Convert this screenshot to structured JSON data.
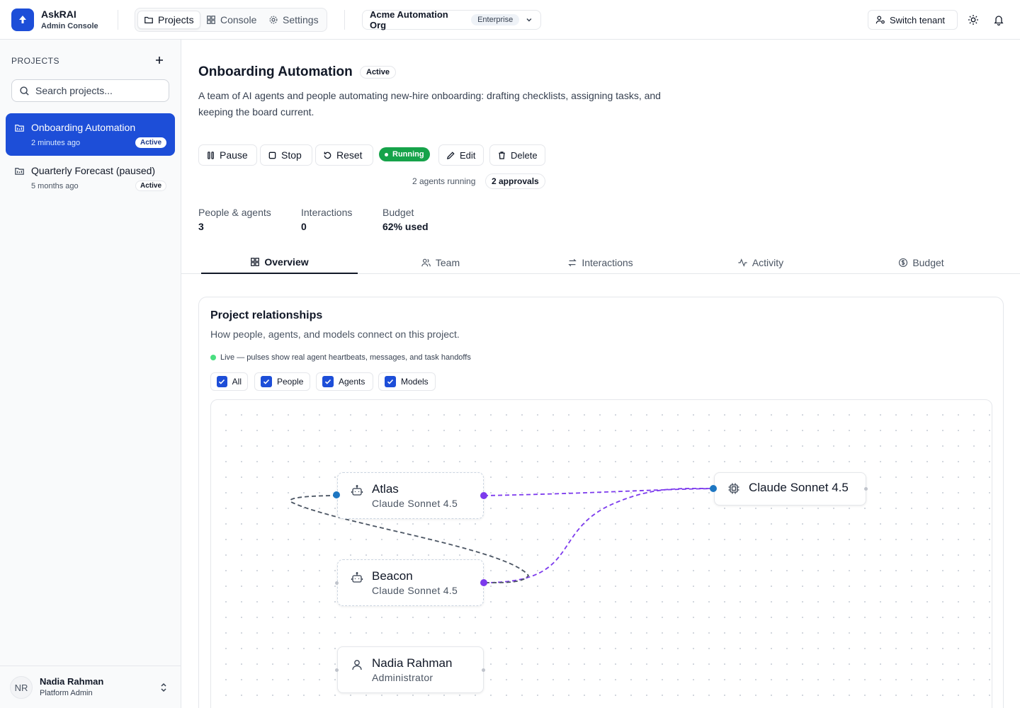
{
  "app": {
    "name": "AskRAI",
    "subtitle": "Admin Console"
  },
  "topnav": [
    {
      "label": "Projects",
      "icon": "folder-icon",
      "active": true
    },
    {
      "label": "Console",
      "icon": "grid-icon",
      "active": false
    },
    {
      "label": "Settings",
      "icon": "gear-icon",
      "active": false
    }
  ],
  "org": {
    "name": "Acme Automation Org",
    "tier": "Enterprise"
  },
  "header_actions": {
    "switch_tenant": "Switch tenant"
  },
  "sidebar": {
    "heading": "PROJECTS",
    "search_placeholder": "Search projects...",
    "projects": [
      {
        "title": "Onboarding Automation",
        "time": "2 minutes ago",
        "badge": "Active",
        "active": true
      },
      {
        "title": "Quarterly Forecast (paused)",
        "time": "5 months ago",
        "badge": "Active",
        "active": false
      }
    ],
    "user": {
      "initials": "NR",
      "name": "Nadia Rahman",
      "role": "Platform Admin"
    }
  },
  "project": {
    "title": "Onboarding Automation",
    "status": "Active",
    "description": "A team of AI agents and people automating new-hire onboarding: drafting checklists, assigning tasks, and keeping the board current.",
    "actions": {
      "pause": "Pause",
      "stop": "Stop",
      "reset": "Reset",
      "running": "Running",
      "edit": "Edit",
      "delete": "Delete"
    },
    "agents_running": "2 agents running",
    "approvals": "2 approvals",
    "stats": [
      {
        "label": "People & agents",
        "value": "3"
      },
      {
        "label": "Interactions",
        "value": "0"
      },
      {
        "label": "Budget",
        "value": "62% used"
      }
    ],
    "tabs": [
      {
        "label": "Overview",
        "icon": "grid-icon",
        "active": true
      },
      {
        "label": "Team",
        "icon": "users-icon",
        "active": false
      },
      {
        "label": "Interactions",
        "icon": "arrows-icon",
        "active": false
      },
      {
        "label": "Activity",
        "icon": "pulse-icon",
        "active": false
      },
      {
        "label": "Budget",
        "icon": "dollar-icon",
        "active": false
      }
    ]
  },
  "relationships": {
    "title": "Project relationships",
    "subtitle": "How people, agents, and models connect on this project.",
    "live_text": "Live — pulses show real agent heartbeats, messages, and task handoffs",
    "filters": [
      {
        "label": "All",
        "checked": true
      },
      {
        "label": "People",
        "checked": true
      },
      {
        "label": "Agents",
        "checked": true
      },
      {
        "label": "Models",
        "checked": true
      }
    ],
    "nodes": {
      "atlas": {
        "name": "Atlas",
        "sub": "Claude Sonnet 4.5",
        "kind": "agent"
      },
      "beacon": {
        "name": "Beacon",
        "sub": "Claude Sonnet 4.5",
        "kind": "agent"
      },
      "model": {
        "name": "Claude Sonnet 4.5",
        "kind": "model"
      },
      "nadia": {
        "name": "Nadia Rahman",
        "sub": "Administrator",
        "kind": "person"
      }
    }
  },
  "colors": {
    "accent": "#1d4ed8",
    "running": "#16a34a",
    "edge_purple": "#7c3aed",
    "edge_gray": "#4b5563",
    "live_dot": "#4ade80"
  }
}
